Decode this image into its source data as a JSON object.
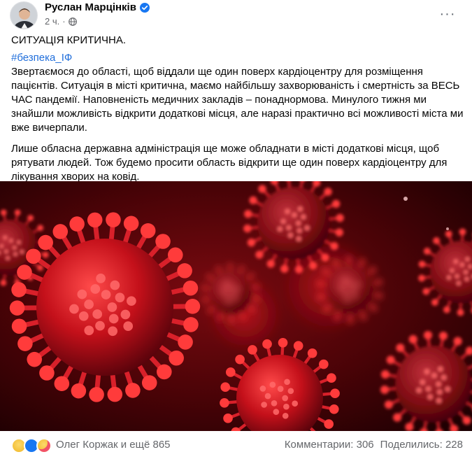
{
  "post": {
    "author": "Руслан Марцінків",
    "time": "2 ч.",
    "more_label": "···",
    "title": "СИТУАЦІЯ КРИТИЧНА.",
    "hashtag": "#безпека_ІФ",
    "paragraph1": "Звертаємося до області, щоб віддали ще один поверх кардіоцентру для розміщення пацієнтів. Ситуація в місті критична, маємо найбільшу захворюваність і смертність за ВЕСЬ ЧАС пандемії. Наповненість медичних закладів – понаднормова. Минулого тижня ми знайшли можливість відкрити додаткові місця, але наразі практично всі можливості міста ми вже вичерпали.",
    "paragraph2": "Лише обласна державна адміністрація ще може обладнати в місті додаткові місця, щоб рятувати людей.  Тож будемо просити область відкрити ще один поверх кардіоцентру для лікування хворих на ковід."
  },
  "footer": {
    "reactions": [
      "sad",
      "like",
      "care"
    ],
    "reactors": "Олег Коржак и ещё 865",
    "comments": "Комментарии: 306",
    "shares": "Поделились: 228"
  },
  "colors": {
    "hashtag": "#216fdb",
    "verified": "#1877f2",
    "secondary_text": "#65676b",
    "virus_red": "#c4101a"
  }
}
